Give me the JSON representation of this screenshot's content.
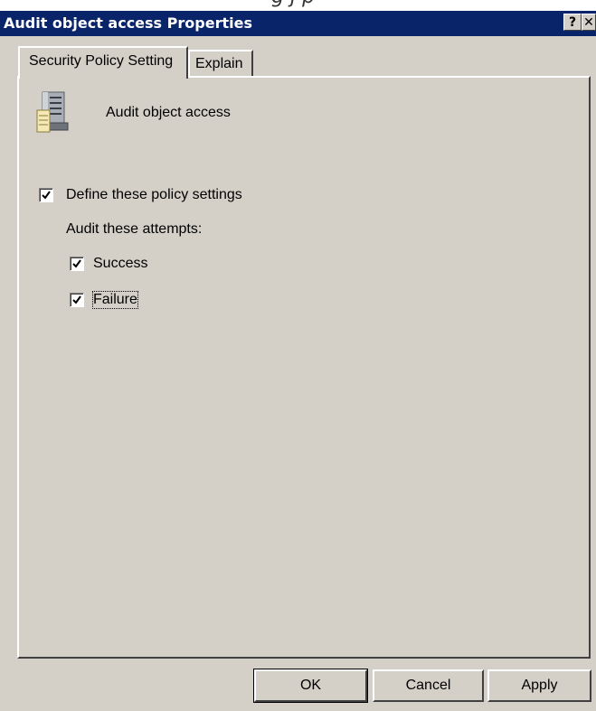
{
  "window": {
    "title": "Audit object access Properties",
    "help_label": "?",
    "close_label": "✕"
  },
  "tabs": [
    {
      "label": "Security Policy Setting",
      "active": true
    },
    {
      "label": "Explain",
      "active": false
    }
  ],
  "policy": {
    "name": "Audit object access",
    "icon": "server-policy-icon"
  },
  "define": {
    "label": "Define these policy settings",
    "checked": true
  },
  "audit_label": "Audit these attempts:",
  "options": [
    {
      "label": "Success",
      "checked": true
    },
    {
      "label": "Failure",
      "checked": true
    }
  ],
  "buttons": {
    "ok": "OK",
    "cancel": "Cancel",
    "apply": "Apply"
  }
}
